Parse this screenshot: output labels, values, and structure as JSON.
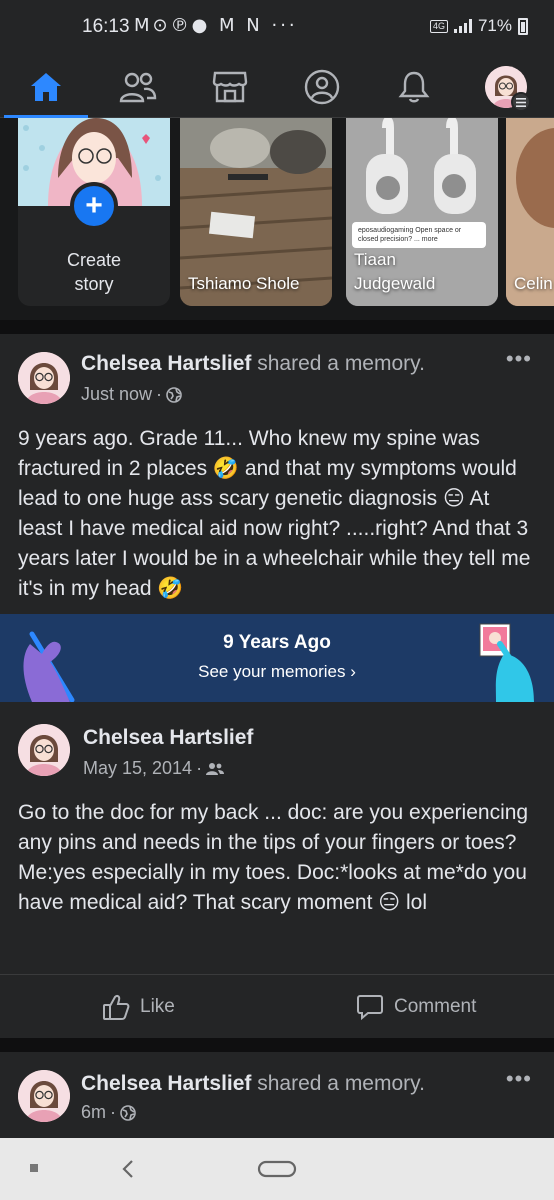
{
  "status_bar": {
    "time": "16:13",
    "notification_glyphs": "M⊙℗● M N ···",
    "network": "4G",
    "battery": "71%"
  },
  "nav": {
    "items": [
      "home",
      "friends",
      "marketplace",
      "profile",
      "notifications",
      "menu"
    ],
    "active": "home"
  },
  "stories": {
    "create_label_line1": "Create",
    "create_label_line2": "story",
    "items": [
      {
        "name": "Tshiamo Shole"
      },
      {
        "name_line1": "Tiaan",
        "name_line2": "Judgewald",
        "caption": "eposaudiogaming Open space or closed precision? ... more"
      },
      {
        "name": "Celin"
      }
    ]
  },
  "post1": {
    "author": "Chelsea Hartslief",
    "action": " shared a memory.",
    "time": "Just now",
    "privacy": "globe-icon",
    "text": "9 years ago. Grade 11... Who knew my spine was fractured in 2 places 🤣 and that my symptoms would lead to one huge ass scary genetic diagnosis 😑 At least I have medical aid now right? .....right? And that 3 years later I would be in a wheelchair while they tell me it's in my head 🤣",
    "memory_banner": {
      "title": "9 Years Ago",
      "link": "See your memories ›"
    },
    "memory_post": {
      "author": "Chelsea Hartslief",
      "date": "May 15, 2014",
      "privacy": "friends-icon",
      "text": "Go to the doc for my back ... doc: are you experiencing any pins and needs in the tips of your fingers or toes? Me:yes especially in my toes. Doc:*looks at me*do you have medical aid? That scary moment 😑 lol"
    },
    "actions": {
      "like": "Like",
      "comment": "Comment"
    }
  },
  "post2": {
    "author": "Chelsea Hartslief",
    "action": " shared a memory.",
    "time": "6m",
    "privacy": "globe-icon"
  },
  "colors": {
    "accent": "#2d88ff",
    "background": "#18191a",
    "card": "#242526",
    "memory_banner": "#1d3a66"
  }
}
